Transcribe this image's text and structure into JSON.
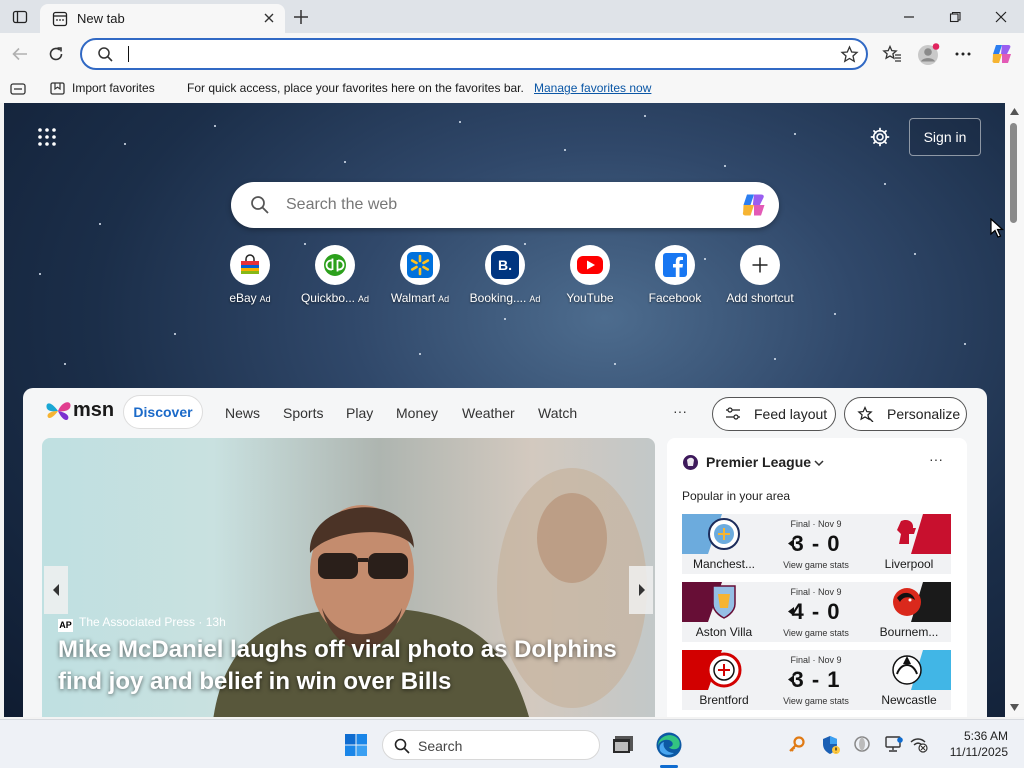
{
  "tab": {
    "title": "New tab"
  },
  "addressbar": {
    "value": ""
  },
  "favorites_bar": {
    "import_label": "Import favorites",
    "hint": "For quick access, place your favorites here on the favorites bar.",
    "manage_link": "Manage favorites now"
  },
  "newtab": {
    "signin": "Sign in",
    "search_placeholder": "Search the web",
    "shortcuts": [
      {
        "label": "eBay",
        "ad": "Ad"
      },
      {
        "label": "Quickbo...",
        "ad": "Ad"
      },
      {
        "label": "Walmart",
        "ad": "Ad"
      },
      {
        "label": "Booking....",
        "ad": "Ad"
      },
      {
        "label": "YouTube",
        "ad": ""
      },
      {
        "label": "Facebook",
        "ad": ""
      },
      {
        "label": "Add shortcut",
        "ad": ""
      }
    ],
    "shortcut_initials": {
      "booking": "B."
    }
  },
  "msn": {
    "logo_text": "msn",
    "nav": [
      "Discover",
      "News",
      "Sports",
      "Play",
      "Money",
      "Weather",
      "Watch"
    ],
    "more": "···",
    "feed_layout": "Feed layout",
    "personalize": "Personalize"
  },
  "hero": {
    "source_logo": "AP",
    "source": "The Associated Press",
    "age": "13h",
    "headline": "Mike McDaniel laughs off viral photo as Dolphins find joy and belief in win over Bills"
  },
  "sports": {
    "league": "Premier League",
    "subtitle": "Popular in your area",
    "more": "···",
    "matches": [
      {
        "home": "Manchest...",
        "away": "Liverpool",
        "status": "Final · Nov 9",
        "score": "3 - 0",
        "stats": "View game stats",
        "home_color": "#6cabdd",
        "away_color": "#c8102e"
      },
      {
        "home": "Aston Villa",
        "away": "Bournem...",
        "status": "Final · Nov 9",
        "score": "4 - 0",
        "stats": "View game stats",
        "home_color": "#670e36",
        "away_color": "#1a1a1a"
      },
      {
        "home": "Brentford",
        "away": "Newcastle",
        "status": "Final · Nov 9",
        "score": "3 - 1",
        "stats": "View game stats",
        "home_color": "#d20000",
        "away_color": "#41b6e6"
      }
    ]
  },
  "taskbar": {
    "search_placeholder": "Search",
    "time": "5:36 AM",
    "date": "11/11/2025"
  },
  "colors": {
    "accent": "#3169c4",
    "msn_blue": "#1b6ac9",
    "link": "#0b57a6"
  }
}
